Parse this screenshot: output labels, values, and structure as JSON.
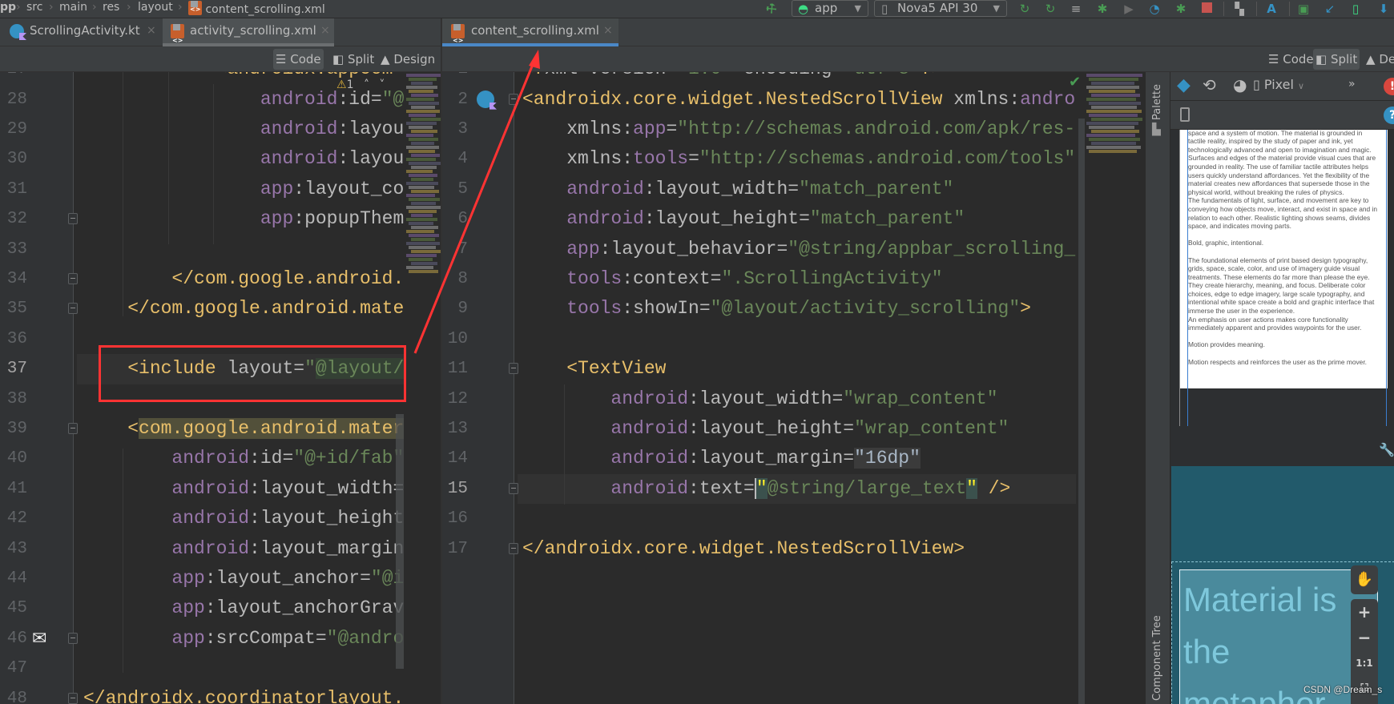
{
  "breadcrumb": [
    "pp",
    "src",
    "main",
    "res",
    "layout",
    "content_scrolling.xml"
  ],
  "toolbar": {
    "run_config": "app",
    "device": "Nova5 API 30",
    "icons": [
      "hammer-icon",
      "rerun-icon",
      "apply-code-changes-icon",
      "apply-changes-icon",
      "debug-icon",
      "attach-debugger-icon",
      "profile-icon",
      "debug-attach-icon",
      "stop-icon",
      "sdk-manager-icon",
      "translate-icon",
      "logcat-icon",
      "sync-icon",
      "device-manager-icon",
      "layout-inspector-icon"
    ],
    "colors": {
      "green": "#499c54",
      "blue": "#3592c4",
      "red": "#c75450"
    }
  },
  "left_pane": {
    "tabs": [
      {
        "label": "ScrollingActivity.kt",
        "icon": "kotlin-activity-icon"
      },
      {
        "label": "activity_scrolling.xml",
        "icon": "xml-icon",
        "active": true
      }
    ],
    "view_modes": [
      "Code",
      "Split",
      "Design"
    ],
    "selected_mode": "Code",
    "warnings": {
      "count": "1"
    },
    "current_line": 37,
    "lines": [
      {
        "num": "27",
        "tokens": [
          {
            "t": "            ",
            "k": "ws"
          },
          {
            "t": "<androidx.appcom",
            "k": "tag"
          }
        ]
      },
      {
        "num": "28",
        "tokens": [
          {
            "t": "                ",
            "k": "ws"
          },
          {
            "t": "android",
            "k": "ns"
          },
          {
            "t": ":id=",
            "k": "attr"
          },
          {
            "t": "\"@",
            "k": "str"
          }
        ]
      },
      {
        "num": "29",
        "tokens": [
          {
            "t": "                ",
            "k": "ws"
          },
          {
            "t": "android",
            "k": "ns"
          },
          {
            "t": ":layou",
            "k": "attr"
          }
        ]
      },
      {
        "num": "30",
        "tokens": [
          {
            "t": "                ",
            "k": "ws"
          },
          {
            "t": "android",
            "k": "ns"
          },
          {
            "t": ":layou",
            "k": "attr"
          }
        ]
      },
      {
        "num": "31",
        "tokens": [
          {
            "t": "                ",
            "k": "ws"
          },
          {
            "t": "app",
            "k": "ns"
          },
          {
            "t": ":layout_co",
            "k": "attr"
          }
        ]
      },
      {
        "num": "32",
        "tokens": [
          {
            "t": "                ",
            "k": "ws"
          },
          {
            "t": "app",
            "k": "ns"
          },
          {
            "t": ":popupThem",
            "k": "attr"
          }
        ]
      },
      {
        "num": "33",
        "tokens": []
      },
      {
        "num": "34",
        "tokens": [
          {
            "t": "        ",
            "k": "ws"
          },
          {
            "t": "</com.google.android.",
            "k": "tag"
          }
        ]
      },
      {
        "num": "35",
        "tokens": [
          {
            "t": "    ",
            "k": "ws"
          },
          {
            "t": "</com.google.android.mate",
            "k": "tag"
          }
        ]
      },
      {
        "num": "36",
        "tokens": []
      },
      {
        "num": "37",
        "tokens": [
          {
            "t": "    ",
            "k": "ws"
          },
          {
            "t": "<include",
            "k": "tag"
          },
          {
            "t": " layout=",
            "k": "attr"
          },
          {
            "t": "\"",
            "k": "str"
          },
          {
            "t": "@layout/",
            "k": "strhl"
          }
        ]
      },
      {
        "num": "38",
        "tokens": []
      },
      {
        "num": "39",
        "tokens": [
          {
            "t": "    ",
            "k": "ws"
          },
          {
            "t": "<",
            "k": "tag"
          },
          {
            "t": "com.google.android.mater",
            "k": "taghl"
          }
        ]
      },
      {
        "num": "40",
        "tokens": [
          {
            "t": "        ",
            "k": "ws"
          },
          {
            "t": "android",
            "k": "ns"
          },
          {
            "t": ":id=",
            "k": "attr"
          },
          {
            "t": "\"@+id/fab\"",
            "k": "str"
          }
        ]
      },
      {
        "num": "41",
        "tokens": [
          {
            "t": "        ",
            "k": "ws"
          },
          {
            "t": "android",
            "k": "ns"
          },
          {
            "t": ":layout_width=",
            "k": "attr"
          }
        ]
      },
      {
        "num": "42",
        "tokens": [
          {
            "t": "        ",
            "k": "ws"
          },
          {
            "t": "android",
            "k": "ns"
          },
          {
            "t": ":layout_height",
            "k": "attr"
          }
        ]
      },
      {
        "num": "43",
        "tokens": [
          {
            "t": "        ",
            "k": "ws"
          },
          {
            "t": "android",
            "k": "ns"
          },
          {
            "t": ":layout_margin",
            "k": "attr"
          }
        ]
      },
      {
        "num": "44",
        "tokens": [
          {
            "t": "        ",
            "k": "ws"
          },
          {
            "t": "app",
            "k": "ns"
          },
          {
            "t": ":layout_anchor=",
            "k": "attr"
          },
          {
            "t": "\"@i",
            "k": "str"
          }
        ]
      },
      {
        "num": "45",
        "tokens": [
          {
            "t": "        ",
            "k": "ws"
          },
          {
            "t": "app",
            "k": "ns"
          },
          {
            "t": ":layout_anchorGrav",
            "k": "attr"
          }
        ]
      },
      {
        "num": "46",
        "tokens": [
          {
            "t": "        ",
            "k": "ws"
          },
          {
            "t": "app",
            "k": "ns"
          },
          {
            "t": ":srcCompat=",
            "k": "attr"
          },
          {
            "t": "\"@andro",
            "k": "str"
          }
        ]
      },
      {
        "num": "47",
        "tokens": []
      },
      {
        "num": "48",
        "tokens": [
          {
            "t": "</androidx.coordinatorlayout.",
            "k": "tag"
          }
        ]
      }
    ]
  },
  "right_pane": {
    "tabs": [
      {
        "label": "content_scrolling.xml",
        "icon": "xml-icon",
        "active": true
      }
    ],
    "view_modes": [
      "Code",
      "Split",
      "De"
    ],
    "selected_mode": "Split",
    "current_line": 15,
    "lines": [
      {
        "num": "1",
        "tokens": [
          {
            "t": "<?",
            "k": "tag"
          },
          {
            "t": "xml version=",
            "k": "attr"
          },
          {
            "t": "\"1.0\"",
            "k": "str"
          },
          {
            "t": " encoding=",
            "k": "attr"
          },
          {
            "t": "\"utf-8\"",
            "k": "str"
          },
          {
            "t": "?>",
            "k": "tag"
          }
        ]
      },
      {
        "num": "2",
        "tokens": [
          {
            "t": "<androidx.core.widget.NestedScrollView",
            "k": "tag"
          },
          {
            "t": " xmlns:",
            "k": "attr"
          },
          {
            "t": "andro",
            "k": "ns"
          }
        ]
      },
      {
        "num": "3",
        "tokens": [
          {
            "t": "    ",
            "k": "ws"
          },
          {
            "t": "xmlns:",
            "k": "attr"
          },
          {
            "t": "app",
            "k": "ns"
          },
          {
            "t": "=",
            "k": "attr"
          },
          {
            "t": "\"http://schemas.android.com/apk/res-a",
            "k": "str"
          }
        ]
      },
      {
        "num": "4",
        "tokens": [
          {
            "t": "    ",
            "k": "ws"
          },
          {
            "t": "xmlns:",
            "k": "attr"
          },
          {
            "t": "tools",
            "k": "ns"
          },
          {
            "t": "=",
            "k": "attr"
          },
          {
            "t": "\"http://schemas.android.com/tools\"",
            "k": "str"
          }
        ]
      },
      {
        "num": "5",
        "tokens": [
          {
            "t": "    ",
            "k": "ws"
          },
          {
            "t": "android",
            "k": "ns"
          },
          {
            "t": ":layout_width=",
            "k": "attr"
          },
          {
            "t": "\"match_parent\"",
            "k": "str"
          }
        ]
      },
      {
        "num": "6",
        "tokens": [
          {
            "t": "    ",
            "k": "ws"
          },
          {
            "t": "android",
            "k": "ns"
          },
          {
            "t": ":layout_height=",
            "k": "attr"
          },
          {
            "t": "\"match_parent\"",
            "k": "str"
          }
        ]
      },
      {
        "num": "7",
        "tokens": [
          {
            "t": "    ",
            "k": "ws"
          },
          {
            "t": "app",
            "k": "ns"
          },
          {
            "t": ":layout_behavior=",
            "k": "attr"
          },
          {
            "t": "\"@string/appbar_scrolling_v",
            "k": "str"
          }
        ]
      },
      {
        "num": "8",
        "tokens": [
          {
            "t": "    ",
            "k": "ws"
          },
          {
            "t": "tools",
            "k": "ns"
          },
          {
            "t": ":context=",
            "k": "attr"
          },
          {
            "t": "\".ScrollingActivity\"",
            "k": "str"
          }
        ]
      },
      {
        "num": "9",
        "tokens": [
          {
            "t": "    ",
            "k": "ws"
          },
          {
            "t": "tools",
            "k": "ns"
          },
          {
            "t": ":showIn=",
            "k": "attr"
          },
          {
            "t": "\"@layout/activity_scrolling\"",
            "k": "str"
          },
          {
            "t": ">",
            "k": "tag"
          }
        ]
      },
      {
        "num": "10",
        "tokens": []
      },
      {
        "num": "11",
        "tokens": [
          {
            "t": "    ",
            "k": "ws"
          },
          {
            "t": "<TextView",
            "k": "tag"
          }
        ]
      },
      {
        "num": "12",
        "tokens": [
          {
            "t": "        ",
            "k": "ws"
          },
          {
            "t": "android",
            "k": "ns"
          },
          {
            "t": ":layout_width=",
            "k": "attr"
          },
          {
            "t": "\"wrap_content\"",
            "k": "str"
          }
        ]
      },
      {
        "num": "13",
        "tokens": [
          {
            "t": "        ",
            "k": "ws"
          },
          {
            "t": "android",
            "k": "ns"
          },
          {
            "t": ":layout_height=",
            "k": "attr"
          },
          {
            "t": "\"wrap_content\"",
            "k": "str"
          }
        ]
      },
      {
        "num": "14",
        "tokens": [
          {
            "t": "        ",
            "k": "ws"
          },
          {
            "t": "android",
            "k": "ns"
          },
          {
            "t": ":layout_margin=",
            "k": "attr"
          },
          {
            "t": "\"16dp\"",
            "k": "dim"
          }
        ]
      },
      {
        "num": "15",
        "tokens": [
          {
            "t": "        ",
            "k": "ws"
          },
          {
            "t": "android",
            "k": "ns"
          },
          {
            "t": ":text=",
            "k": "attr"
          },
          {
            "t": "\"",
            "k": "brace caret"
          },
          {
            "t": "@string/large_text",
            "k": "str"
          },
          {
            "t": "\"",
            "k": "brace"
          },
          {
            "t": " />",
            "k": "tag"
          }
        ]
      },
      {
        "num": "16",
        "tokens": []
      },
      {
        "num": "17",
        "tokens": [
          {
            "t": "</androidx.core.widget.NestedScrollView>",
            "k": "tag"
          }
        ]
      }
    ]
  },
  "side_strip": {
    "palette": "Palette",
    "component_tree": "Component Tree"
  },
  "design": {
    "device": "Pixel",
    "overflow": "»",
    "preview_paragraphs": [
      "A material metaphor is the unifying theory of a rationalized space and a system of motion. The material is grounded in tactile reality, inspired by the study of paper and ink, yet technologically advanced and open to imagination and magic.",
      "Surfaces and edges of the material provide visual cues that are grounded in reality. The use of familiar tactile attributes helps users quickly understand affordances. Yet the flexibility of the material creates new affordances that supersede those in the physical world, without breaking the rules of physics.",
      "The fundamentals of light, surface, and movement are key to conveying how objects move, interact, and exist in space and in relation to each other. Realistic lighting shows seams, divides space, and indicates moving parts.",
      "Bold, graphic, intentional.",
      "The foundational elements of print based design typography, grids, space, scale, color, and use of imagery guide visual treatments. These elements do far more than please the eye. They create hierarchy, meaning, and focus. Deliberate color choices, edge to edge imagery, large scale typography, and intentional white space create a bold and graphic interface that immerse the user in the experience.",
      "An emphasis on user actions makes core functionality immediately apparent and provides waypoints for the user.",
      "Motion provides meaning.",
      "Motion respects and reinforces the user as the prime mover."
    ],
    "blueprint_text": "Material is the metaphor",
    "zoom_controls": {
      "plus": "+",
      "minus": "−",
      "actual": "1:1"
    }
  },
  "watermark": "CSDN @Dream_s",
  "annotation_color": "#ff3333"
}
